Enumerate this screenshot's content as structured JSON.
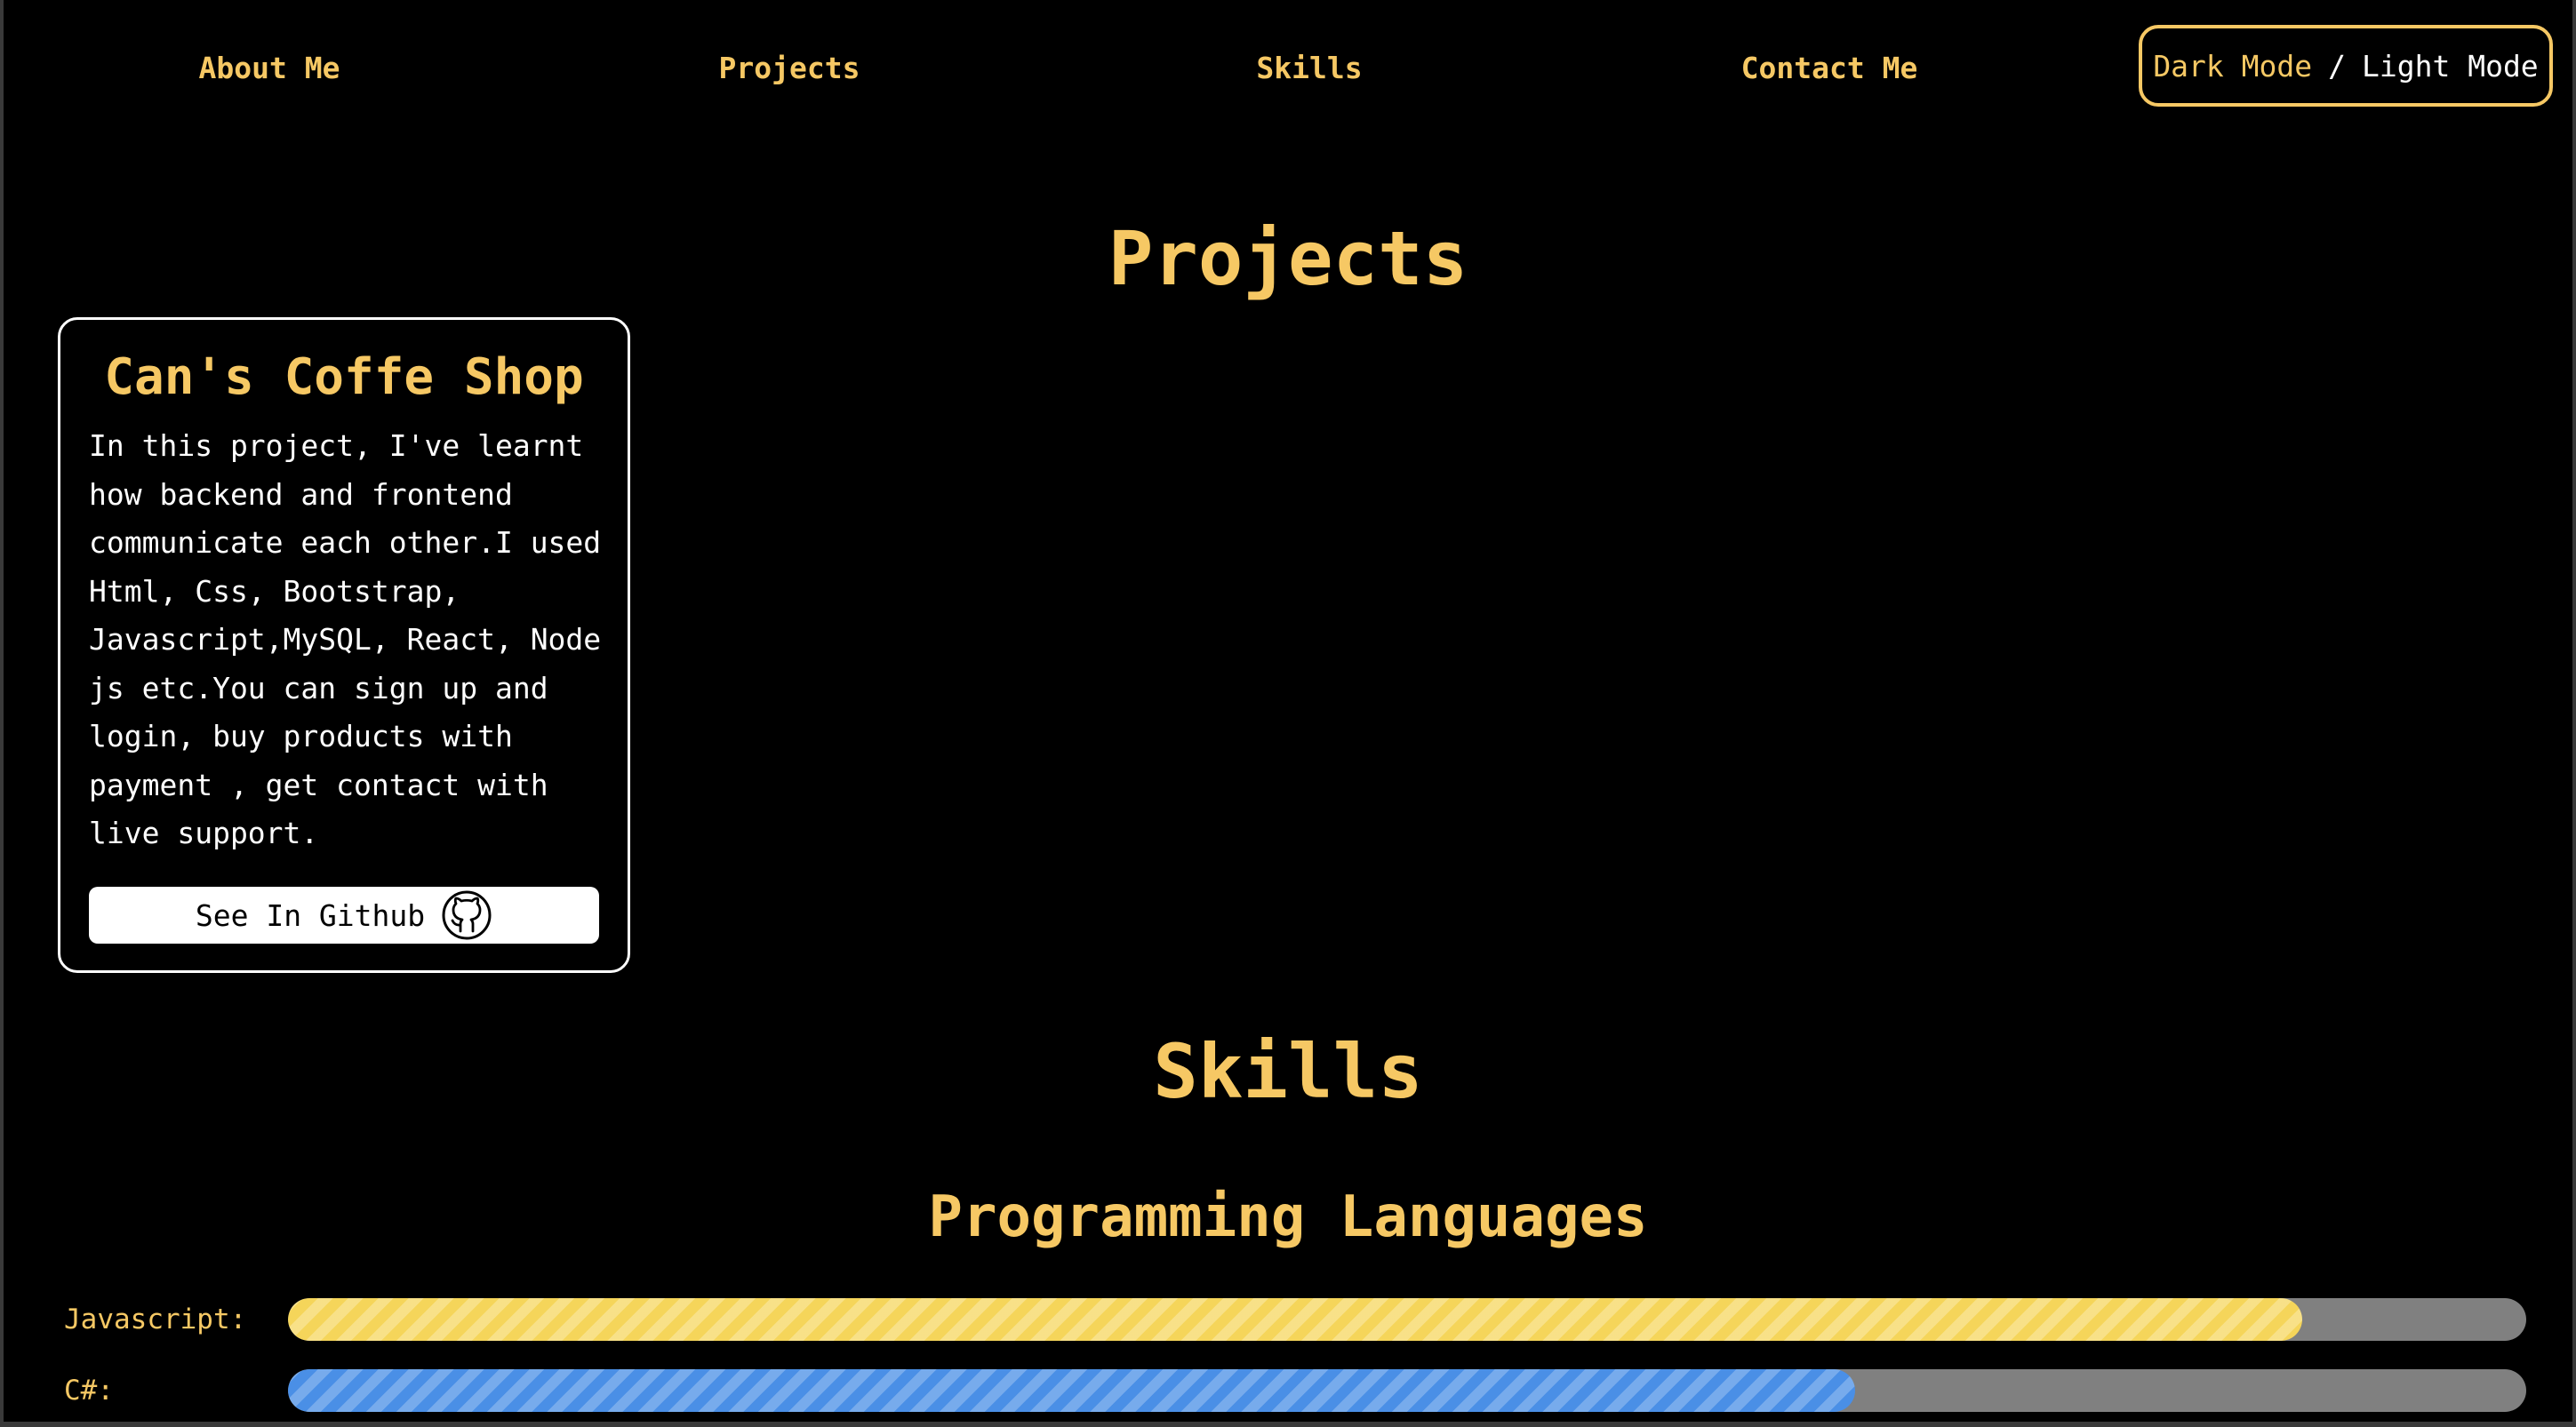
{
  "nav": {
    "items": [
      {
        "label": "About Me"
      },
      {
        "label": "Projects"
      },
      {
        "label": "Skills"
      },
      {
        "label": "Contact Me"
      }
    ],
    "mode_toggle": {
      "dark_label": "Dark Mode",
      "separator": "/",
      "light_label": "Light Mode"
    }
  },
  "projects": {
    "title": "Projects",
    "cards": [
      {
        "title": "Can's Coffe Shop",
        "description": "In this project, I've learnt how backend and frontend communicate each other.I used Html, Css, Bootstrap, Javascript,MySQL, React, Node js etc.You can sign up and login, buy products with payment , get contact with live support.",
        "button_label": "See In Github",
        "button_icon": "github-icon"
      }
    ]
  },
  "skills": {
    "title": "Skills",
    "programming_languages": {
      "title": "Programming Languages",
      "items": [
        {
          "label": "Javascript:",
          "level": 0.9,
          "color": "#f5d55a"
        },
        {
          "label": "C#:",
          "level": 0.7,
          "color": "#4a8fe6"
        }
      ]
    }
  },
  "colors": {
    "accent": "#f6c864",
    "background": "#000000",
    "text": "#ffffff",
    "track": "#808080"
  }
}
